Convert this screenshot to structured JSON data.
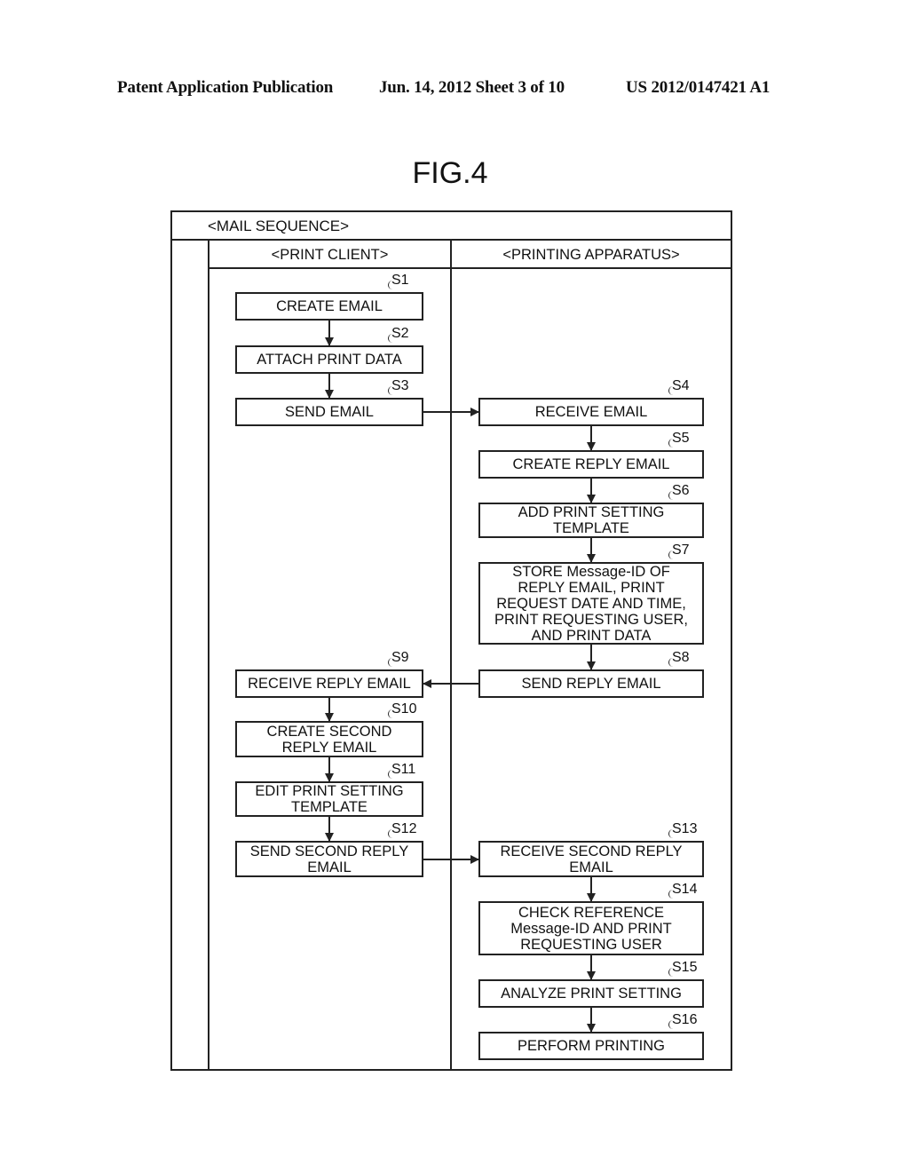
{
  "header": {
    "publication": "Patent Application Publication",
    "date_sheet": "Jun. 14, 2012  Sheet 3 of 10",
    "number": "US 2012/0147421 A1"
  },
  "figure": {
    "title": "FIG.4",
    "sequence_title": "<MAIL SEQUENCE>",
    "lanes": [
      {
        "label": "<PRINT CLIENT>"
      },
      {
        "label": "<PRINTING APPARATUS>"
      }
    ],
    "steps": [
      {
        "id": "S1",
        "lane": 0,
        "text": "CREATE EMAIL"
      },
      {
        "id": "S2",
        "lane": 0,
        "text": "ATTACH PRINT DATA"
      },
      {
        "id": "S3",
        "lane": 0,
        "text": "SEND EMAIL"
      },
      {
        "id": "S4",
        "lane": 1,
        "text": "RECEIVE EMAIL"
      },
      {
        "id": "S5",
        "lane": 1,
        "text": "CREATE REPLY EMAIL"
      },
      {
        "id": "S6",
        "lane": 1,
        "text": "ADD PRINT SETTING\nTEMPLATE"
      },
      {
        "id": "S7",
        "lane": 1,
        "text": "STORE Message-ID OF\nREPLY EMAIL, PRINT\nREQUEST DATE AND TIME,\nPRINT REQUESTING USER,\nAND PRINT DATA"
      },
      {
        "id": "S8",
        "lane": 1,
        "text": "SEND REPLY EMAIL"
      },
      {
        "id": "S9",
        "lane": 0,
        "text": "RECEIVE REPLY EMAIL"
      },
      {
        "id": "S10",
        "lane": 0,
        "text": "CREATE SECOND\nREPLY EMAIL"
      },
      {
        "id": "S11",
        "lane": 0,
        "text": "EDIT PRINT SETTING\nTEMPLATE"
      },
      {
        "id": "S12",
        "lane": 0,
        "text": "SEND SECOND REPLY\nEMAIL"
      },
      {
        "id": "S13",
        "lane": 1,
        "text": "RECEIVE SECOND REPLY\nEMAIL"
      },
      {
        "id": "S14",
        "lane": 1,
        "text": "CHECK REFERENCE\nMessage-ID AND PRINT\nREQUESTING USER"
      },
      {
        "id": "S15",
        "lane": 1,
        "text": "ANALYZE PRINT SETTING"
      },
      {
        "id": "S16",
        "lane": 1,
        "text": "PERFORM PRINTING"
      }
    ],
    "flows": [
      [
        "S1",
        "S2"
      ],
      [
        "S2",
        "S3"
      ],
      [
        "S3",
        "S4"
      ],
      [
        "S4",
        "S5"
      ],
      [
        "S5",
        "S6"
      ],
      [
        "S6",
        "S7"
      ],
      [
        "S7",
        "S8"
      ],
      [
        "S8",
        "S9"
      ],
      [
        "S9",
        "S10"
      ],
      [
        "S10",
        "S11"
      ],
      [
        "S11",
        "S12"
      ],
      [
        "S12",
        "S13"
      ],
      [
        "S13",
        "S14"
      ],
      [
        "S14",
        "S15"
      ],
      [
        "S15",
        "S16"
      ]
    ]
  }
}
